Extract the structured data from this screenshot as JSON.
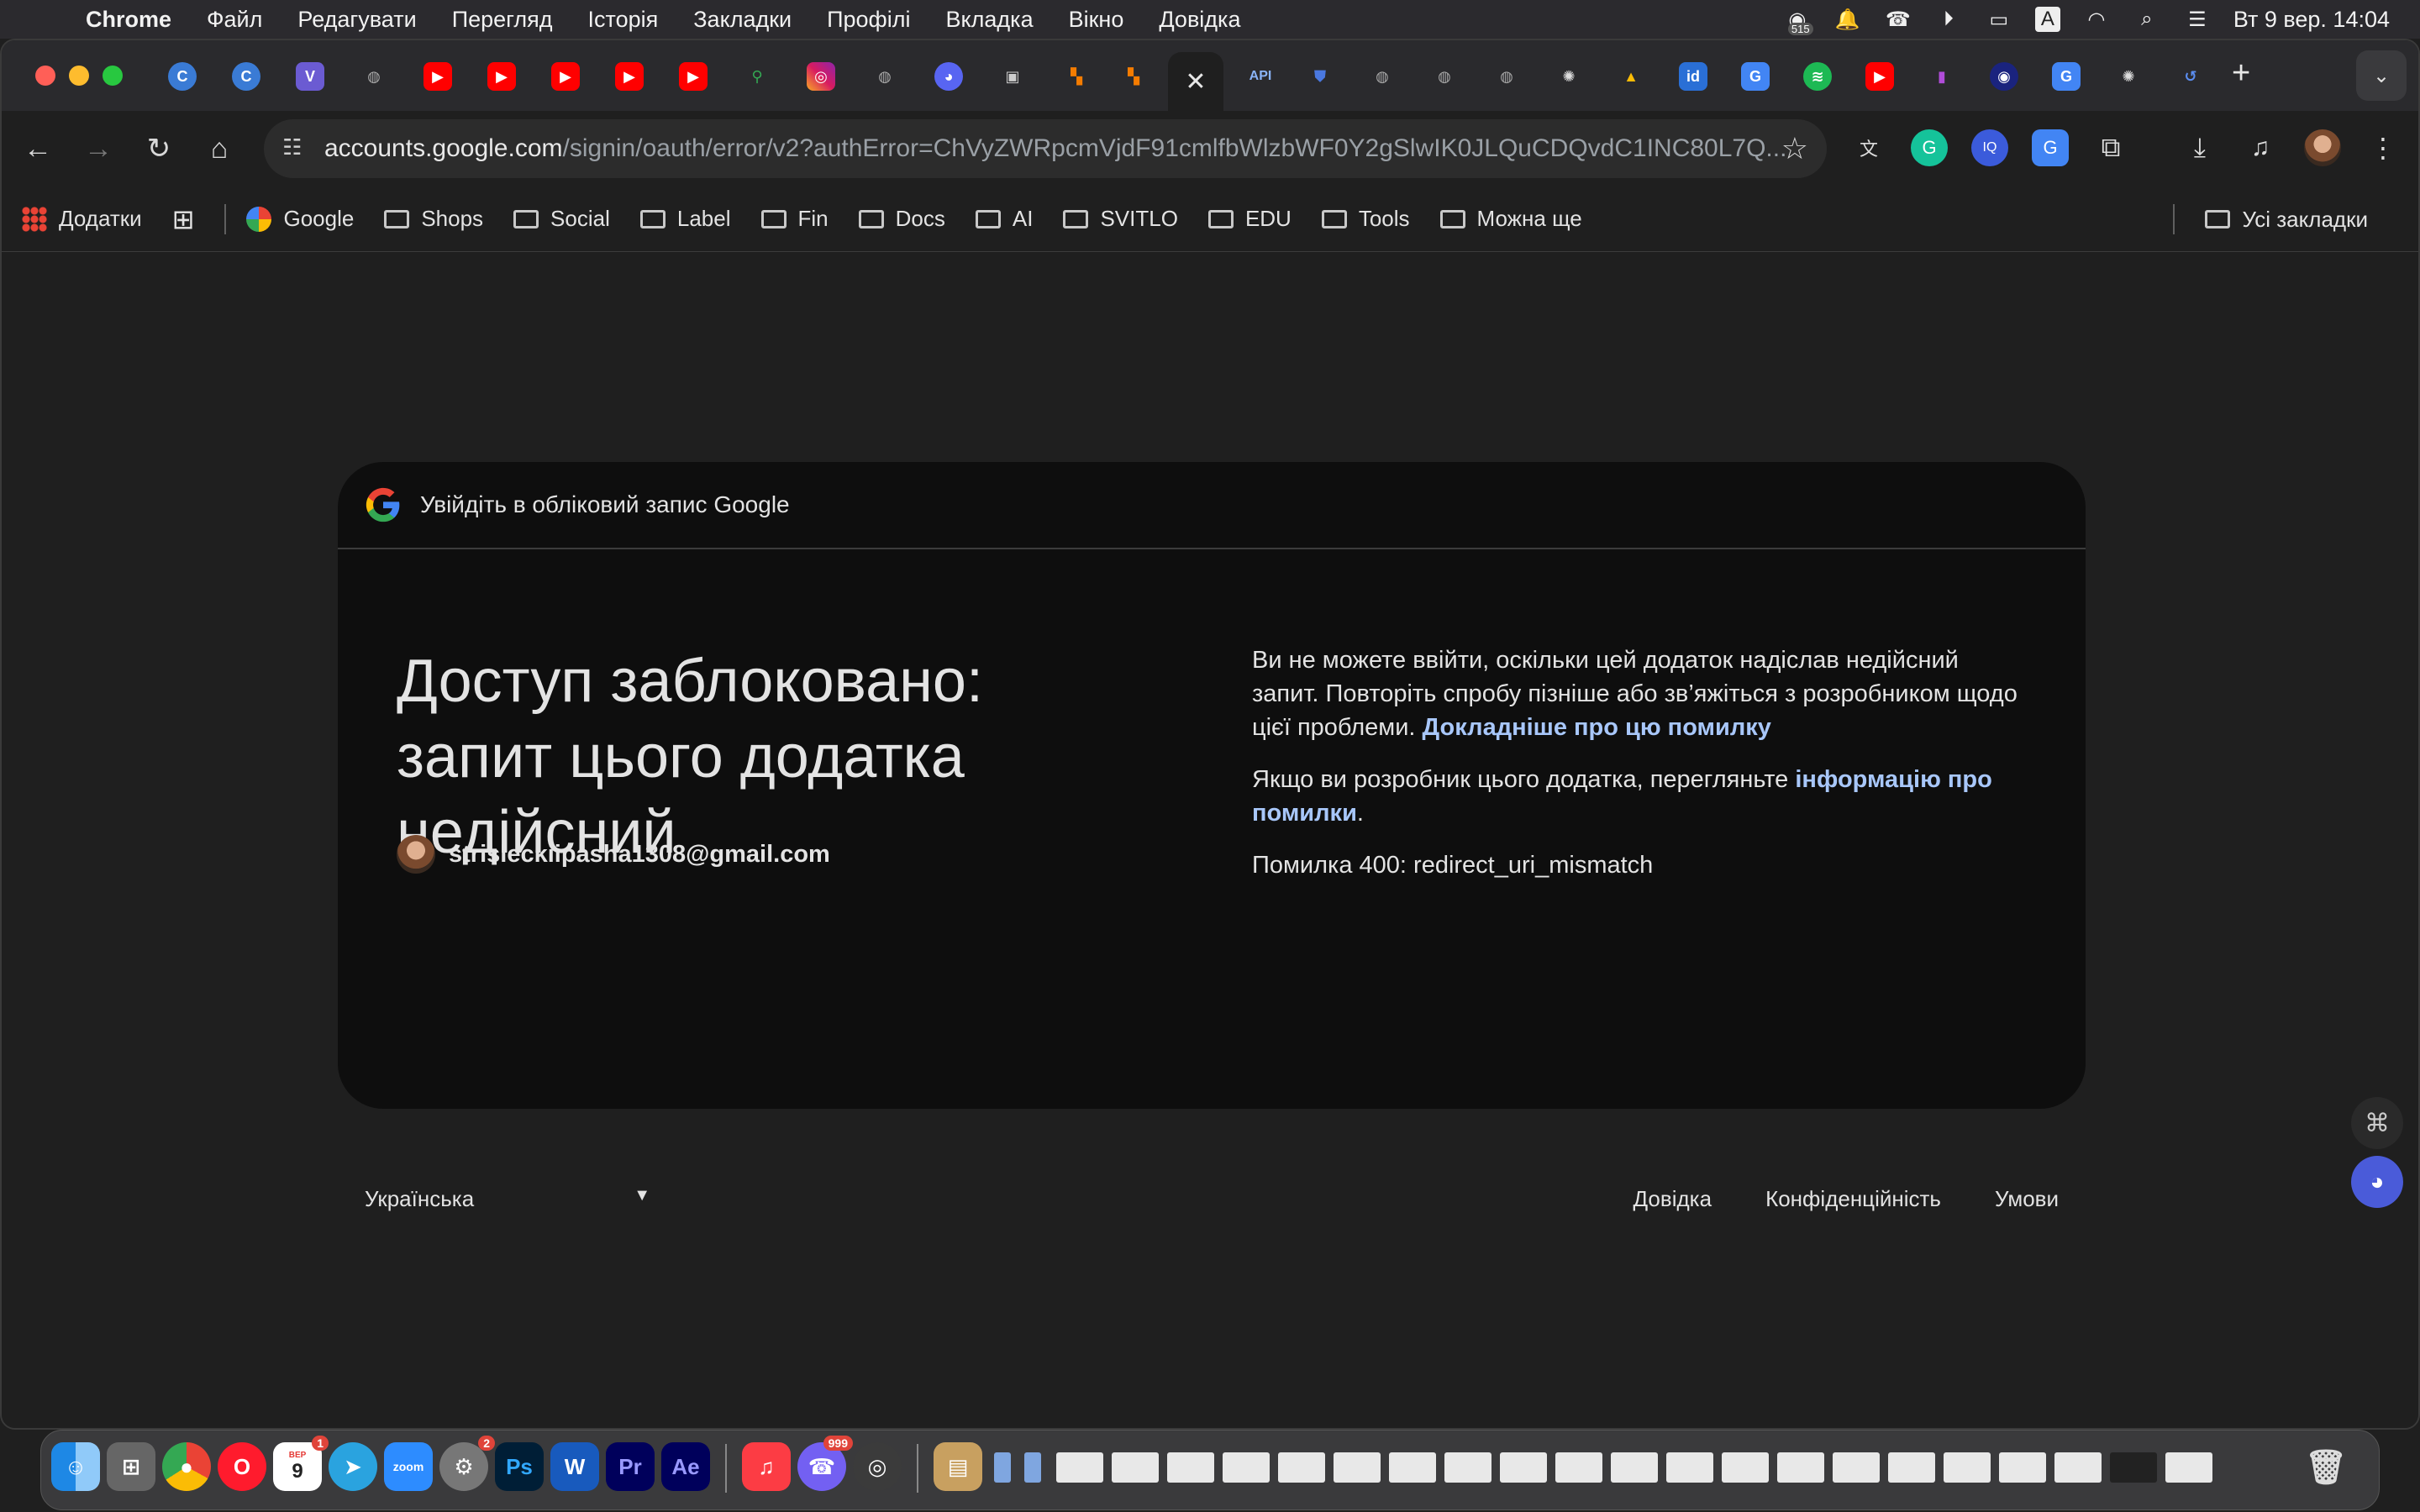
{
  "menubar": {
    "app_name": "Chrome",
    "items": [
      "Файл",
      "Редагувати",
      "Перегляд",
      "Історія",
      "Закладки",
      "Профілі",
      "Вкладка",
      "Вікно",
      "Довідка"
    ],
    "notification_count": "515",
    "input_source": "A",
    "clock": "Вт 9 вер.  14:04"
  },
  "toolbar": {
    "url_host": "accounts.google.com",
    "url_path": "/signin/oauth/error/v2?authError=ChVyZWRpcmVjdF91cmlfbWlzbWF0Y2gSlwIK0JLQuCDQvdC1INC80L7Q...",
    "tab_api_label": "API"
  },
  "bookmarks": {
    "items": [
      "Додатки",
      "Google",
      "Shops",
      "Social",
      "Label",
      "Fin",
      "Docs",
      "AI",
      "SVITLO",
      "EDU",
      "Tools",
      "Можна ще"
    ],
    "all_bookmarks": "Усі закладки"
  },
  "card": {
    "header": "Увійдіть в обліковий запис Google",
    "headline": "Доступ заблоковано: запит цього додатка недійсний",
    "account_email": "strisleckiipasha1308@gmail.com",
    "msg1_text": "Ви не можете ввійти, оскільки цей додаток надіслав недійсний запит. Повторіть спробу пізніше або зв’яжіться з розробником щодо цієї проблеми. ",
    "msg1_link": "Докладніше про цю помилку",
    "msg2_text": "Якщо ви розробник цього додатка, перегляньте ",
    "msg2_link": "інформацію про помилки",
    "msg2_end": ".",
    "error_code": "Помилка 400: redirect_uri_mismatch"
  },
  "footer": {
    "language": "Українська",
    "links": [
      "Довідка",
      "Конфіденційність",
      "Умови"
    ]
  },
  "dock": {
    "calendar_month": "ВЕР",
    "calendar_day": "9",
    "calendar_badge": "1",
    "settings_badge": "2",
    "viber_badge": "999",
    "zoom_label": "zoom",
    "ps_label": "Ps",
    "word_label": "W",
    "pr_label": "Pr",
    "ae_label": "Ae"
  },
  "colors": {
    "accent_link": "#a8c7fa",
    "card_bg": "#0e0e0e",
    "page_bg": "#1f1f1f"
  }
}
